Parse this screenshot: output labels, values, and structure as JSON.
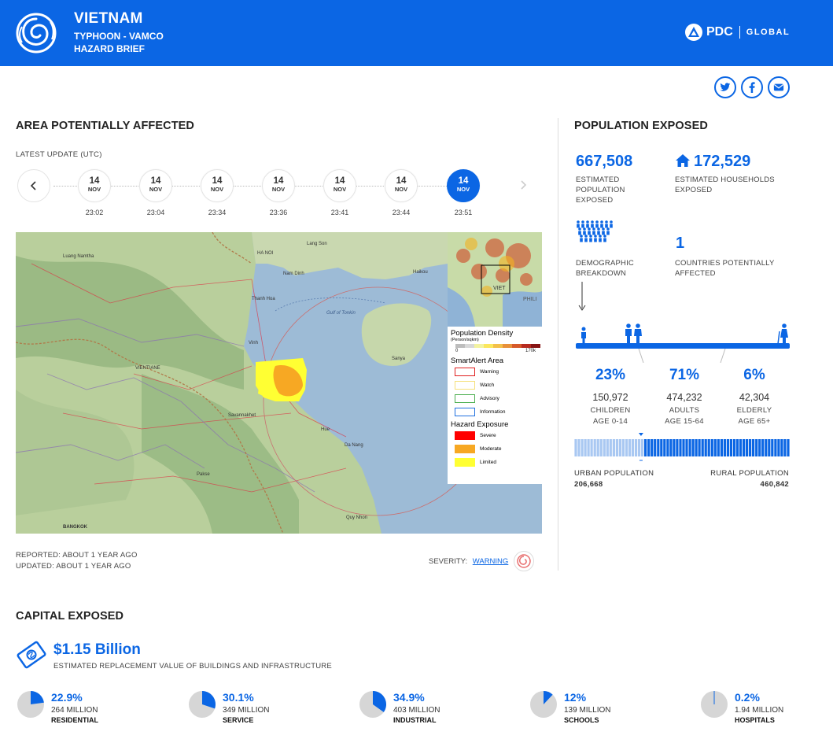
{
  "header": {
    "country": "VIETNAM",
    "event": "TYPHOON - VAMCO",
    "doc_type": "HAZARD BRIEF",
    "brand": "PDC",
    "brand_sub": "GLOBAL",
    "bg_color": "#0b66e4"
  },
  "share": [
    {
      "icon": "twitter-icon"
    },
    {
      "icon": "facebook-icon"
    },
    {
      "icon": "email-icon"
    }
  ],
  "area": {
    "title": "AREA POTENTIALLY AFFECTED",
    "latest_update": "LATEST UPDATE (UTC)",
    "timeline": [
      {
        "day": "14",
        "month": "NOV",
        "time": "23:02",
        "active": false
      },
      {
        "day": "14",
        "month": "NOV",
        "time": "23:04",
        "active": false
      },
      {
        "day": "14",
        "month": "NOV",
        "time": "23:34",
        "active": false
      },
      {
        "day": "14",
        "month": "NOV",
        "time": "23:36",
        "active": false
      },
      {
        "day": "14",
        "month": "NOV",
        "time": "23:41",
        "active": false
      },
      {
        "day": "14",
        "month": "NOV",
        "time": "23:44",
        "active": false
      },
      {
        "day": "14",
        "month": "NOV",
        "time": "23:51",
        "active": true
      }
    ],
    "reported": "REPORTED: ABOUT 1 YEAR AGO",
    "updated": "UPDATED: ABOUT 1 YEAR AGO",
    "severity_label": "SEVERITY:",
    "severity_value": "WARNING"
  },
  "map": {
    "labels": {
      "hanoi": "HA NOI",
      "gulf": "Gulf of Tonkin",
      "vientiane": "VIENTIANE",
      "danang": "Da Nang",
      "hue": "Hue",
      "bangkok": "BANGKOK",
      "lang_son": "Lang Son",
      "nam_dinh": "Nam Dinh",
      "thanh_hoa": "Thanh Hoa",
      "vinh": "Vinh",
      "haikou": "Haikou",
      "sanya": "Sanya",
      "phil": "PHILI",
      "viet": "VIET",
      "luang": "Luang Namtha",
      "savann": "Savannakhet",
      "pakse": "Pakse",
      "quy": "Quy Nhon"
    },
    "legend": {
      "density_title": "Population Density",
      "density_unit": "(Person/sqkm)",
      "density_min": "0",
      "density_max": "170k",
      "smartalert_title": "SmartAlert Area",
      "smartalert_items": [
        {
          "label": "Warning",
          "color": "#e02020"
        },
        {
          "label": "Watch",
          "color": "#f5e07a"
        },
        {
          "label": "Advisory",
          "color": "#4caf50"
        },
        {
          "label": "Information",
          "color": "#2070e0"
        }
      ],
      "exposure_title": "Hazard Exposure",
      "exposure_items": [
        {
          "label": "Severe",
          "color": "#ff0000"
        },
        {
          "label": "Moderate",
          "color": "#f7a823"
        },
        {
          "label": "Limited",
          "color": "#ffff33"
        }
      ]
    }
  },
  "population": {
    "title": "POPULATION EXPOSED",
    "estimated_population": "667,508",
    "estimated_population_label": "ESTIMATED POPULATION EXPOSED",
    "households": "172,529",
    "households_label": "ESTIMATED HOUSEHOLDS EXPOSED",
    "demographic_label": "DEMOGRAPHIC BREAKDOWN",
    "countries": "1",
    "countries_label": "COUNTRIES POTENTIALLY AFFECTED",
    "children_pct": "23%",
    "children_count": "150,972",
    "children_label": "CHILDREN",
    "children_age": "AGE 0-14",
    "adults_pct": "71%",
    "adults_count": "474,232",
    "adults_label": "ADULTS",
    "adults_age": "AGE 15-64",
    "elderly_pct": "6%",
    "elderly_count": "42,304",
    "elderly_label": "ELDERLY",
    "elderly_age": "AGE 65+",
    "urban_label": "URBAN POPULATION",
    "urban_value": "206,668",
    "rural_label": "RURAL POPULATION",
    "rural_value": "460,842",
    "urban_fraction": 0.31
  },
  "capital": {
    "title": "CAPITAL EXPOSED",
    "total": "$1.15 Billion",
    "total_label": "ESTIMATED REPLACEMENT VALUE OF BUILDINGS AND INFRASTRUCTURE",
    "items": [
      {
        "pct": "22.9%",
        "fraction": 0.229,
        "amount": "264 MILLION",
        "label": "RESIDENTIAL"
      },
      {
        "pct": "30.1%",
        "fraction": 0.301,
        "amount": "349 MILLION",
        "label": "SERVICE"
      },
      {
        "pct": "34.9%",
        "fraction": 0.349,
        "amount": "403 MILLION",
        "label": "INDUSTRIAL"
      },
      {
        "pct": "12%",
        "fraction": 0.12,
        "amount": "139 MILLION",
        "label": "SCHOOLS"
      },
      {
        "pct": "0.2%",
        "fraction": 0.002,
        "amount": "1.94 MILLION",
        "label": "HOSPITALS"
      }
    ],
    "pie_color": "#0b66e4",
    "pie_bg": "#d6d6d6"
  }
}
